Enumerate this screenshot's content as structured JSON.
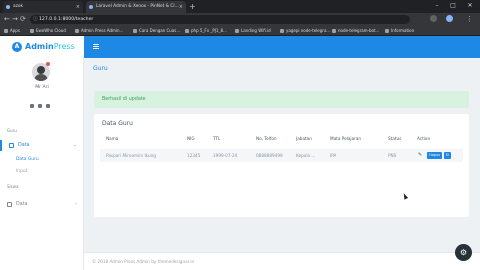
{
  "browser": {
    "tabs": [
      {
        "title": "azok",
        "active": false
      },
      {
        "title": "Laravel Admin & Xenox - PinNet & Cl...",
        "active": true
      }
    ],
    "new_tab": "+",
    "window_controls": [
      "–",
      "□",
      "✕"
    ],
    "url": "127.0.0.1:8000/teacher",
    "nav": {
      "back": "←",
      "forward": "→",
      "reload": "⟳"
    },
    "bookmarks": [
      "Apps",
      "EwoWho Cloud",
      "Admin Press Admin...",
      "Cara Dengan Cuas...",
      "php 5_Fx _PJ1_8...",
      "Landing Wifi.id",
      "yagepi node-telegra...",
      "node-telegram-bot...",
      "Information"
    ]
  },
  "sidebar": {
    "brand_main": "Admin",
    "brand_accent": "Press",
    "username": "Mr Ari",
    "sections": [
      {
        "label": "Guru"
      },
      {
        "label": "Siswa"
      }
    ],
    "menu": [
      {
        "label": "Data",
        "active": true
      },
      {
        "label": "Data",
        "active": false
      }
    ],
    "submenu": [
      {
        "label": "Data Guru",
        "active": true
      },
      {
        "label": "Input",
        "active": false
      }
    ]
  },
  "page": {
    "title": "Guru",
    "alert": "Berhasil di update",
    "card_title": "Data Guru",
    "columns": [
      "Nama",
      "NIG",
      "TTL",
      "No. Telfon",
      "Jabatan",
      "Mata Pelajaran",
      "Status",
      "Action"
    ],
    "rows": [
      {
        "cells": [
          "Paspari Miroomiin Ikung",
          "12345",
          "1999-07-24",
          "0888889499",
          "Kepala ...",
          "IPA",
          "PNS"
        ],
        "delete_label": "Hapus",
        "extra_label": "Ei"
      }
    ],
    "footer": "© 2018 Admin Press Admin by themedesigner.in"
  },
  "colors": {
    "primary": "#1e88e5",
    "alert_bg": "#d7f3df",
    "alert_text": "#3c9b5a"
  }
}
